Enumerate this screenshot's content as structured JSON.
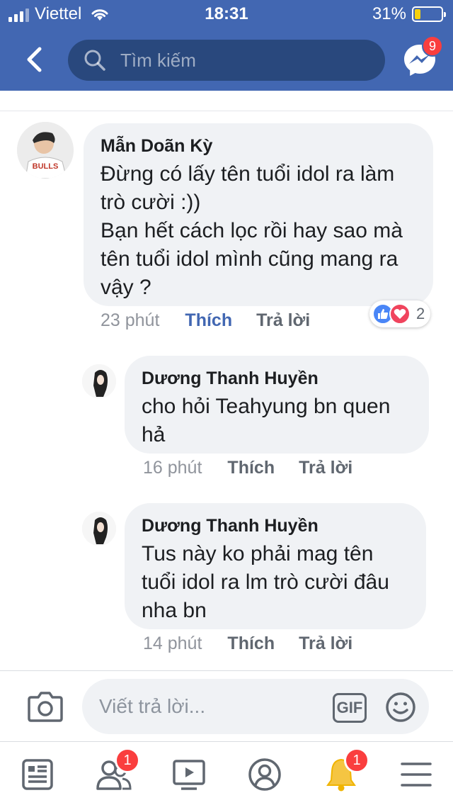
{
  "status_bar": {
    "carrier": "Viettel",
    "time": "18:31",
    "battery_percent": "31%",
    "battery_level": 0.31,
    "battery_color": "#f5d10e"
  },
  "header": {
    "back_icon": "chevron-left-icon",
    "search_placeholder": "Tìm kiếm",
    "messenger_icon": "messenger-icon",
    "messenger_badge": "9",
    "bar_color": "#4267b2"
  },
  "comments": [
    {
      "author": "Mẫn Doãn Kỳ",
      "text": "Đừng có lấy tên tuổi idol ra làm trò cười :))\nBạn hết cách lọc rồi hay sao mà tên tuổi idol mình cũng mang ra vậy ?",
      "time": "23 phút",
      "like_label": "Thích",
      "reply_label": "Trả lời",
      "liked": true,
      "reactions": {
        "types": [
          "like",
          "love"
        ],
        "count": "2"
      }
    },
    {
      "author": "Dương Thanh Huyền",
      "text": "cho hỏi Teahyung bn quen hả",
      "time": "16 phút",
      "like_label": "Thích",
      "reply_label": "Trả lời",
      "liked": false
    },
    {
      "author": "Dương Thanh Huyền",
      "text": "Tus này ko phải mag tên tuổi idol ra lm trò cười đâu nha bn",
      "time": "14 phút",
      "like_label": "Thích",
      "reply_label": "Trả lời",
      "liked": false
    }
  ],
  "composer": {
    "placeholder": "Viết trả lời...",
    "gif_label": "GIF",
    "camera_icon": "camera-icon",
    "emoji_icon": "emoji-icon"
  },
  "nav": {
    "items": [
      {
        "icon": "news-feed-icon"
      },
      {
        "icon": "friends-icon",
        "badge": "1"
      },
      {
        "icon": "watch-video-icon"
      },
      {
        "icon": "profile-icon"
      },
      {
        "icon": "notifications-bell-icon",
        "badge": "1"
      },
      {
        "icon": "menu-icon"
      }
    ]
  },
  "colors": {
    "link_blue": "#4267b2",
    "badge_red": "#fa3e3e",
    "bubble_gray": "#f0f2f5",
    "like_blue": "#4a86f7",
    "love_red": "#f0445d"
  }
}
